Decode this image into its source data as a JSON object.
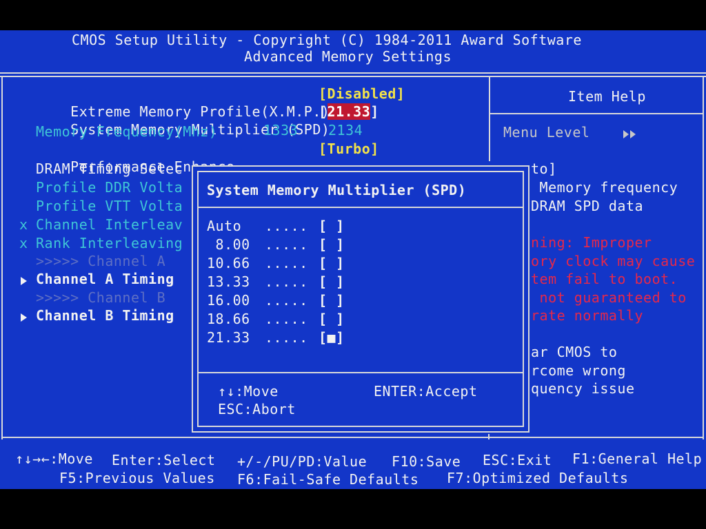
{
  "header": {
    "title": "CMOS Setup Utility - Copyright (C) 1984-2011 Award Software",
    "subtitle": "Advanced Memory Settings"
  },
  "menu": {
    "xmp": {
      "label": "Extreme Memory Profile(X.M.P.)",
      "value": "[Disabled]"
    },
    "multiplier": {
      "label": "System Memory Multiplier (SPD)",
      "value_open": "[",
      "value": "21.33",
      "value_close": "]"
    },
    "frequency": {
      "label": "Memory Frequency(Mhz)",
      "value1": "1333",
      "value2": "2134"
    },
    "perf": {
      "label": "Performance Enhance",
      "value": "[Turbo]"
    },
    "dram_timing": {
      "label": "DRAM Timing Selec"
    },
    "profile_ddr": {
      "label": "Profile DDR Volta"
    },
    "profile_vtt": {
      "label": "Profile VTT Volta"
    },
    "channel_interleave": {
      "prefix": "x",
      "label": "Channel Interleav"
    },
    "rank_interleave": {
      "prefix": "x",
      "label": "Rank Interleaving"
    },
    "channel_a_header": ">>>>> Channel A",
    "channel_a_timing": "Channel A Timing",
    "channel_b_header": ">>>>> Channel B",
    "channel_b_timing": "Channel B Timing"
  },
  "item_help": {
    "title": "Item Help",
    "menu_level_label": "Menu Level",
    "lines": [
      {
        "text": "to]",
        "color": "white"
      },
      {
        "text": " Memory frequency",
        "color": "white"
      },
      {
        "text": "DRAM SPD data",
        "color": "white"
      },
      {
        "text": "ning: Improper",
        "color": "red"
      },
      {
        "text": "ory clock may cause",
        "color": "red"
      },
      {
        "text": "tem fail to boot.",
        "color": "red"
      },
      {
        "text": " not guaranteed to",
        "color": "red"
      },
      {
        "text": "rate normally",
        "color": "red"
      },
      {
        "text": "ar CMOS to",
        "color": "white"
      },
      {
        "text": "rcome wrong",
        "color": "white"
      },
      {
        "text": "quency issue",
        "color": "white"
      }
    ]
  },
  "popup": {
    "title": "System Memory Multiplier (SPD)",
    "options": [
      {
        "label": "Auto ",
        "dots": ".....",
        "mark": "[ ]",
        "selected": false
      },
      {
        "label": " 8.00",
        "dots": ".....",
        "mark": "[ ]",
        "selected": false
      },
      {
        "label": "10.66",
        "dots": ".....",
        "mark": "[ ]",
        "selected": false
      },
      {
        "label": "13.33",
        "dots": ".....",
        "mark": "[ ]",
        "selected": false
      },
      {
        "label": "16.00",
        "dots": ".....",
        "mark": "[ ]",
        "selected": false
      },
      {
        "label": "18.66",
        "dots": ".....",
        "mark": "[ ]",
        "selected": false
      },
      {
        "label": "21.33",
        "dots": ".....",
        "mark": "[■]",
        "selected": true
      }
    ],
    "move": "↑↓:Move",
    "accept": "ENTER:Accept",
    "abort": "ESC:Abort"
  },
  "footer": {
    "move": "↑↓→←:Move",
    "select": "Enter:Select",
    "value": "+/-/PU/PD:Value",
    "save": "F10:Save",
    "exit": "ESC:Exit",
    "help": "F1:General Help",
    "previous": "F5:Previous Values",
    "failsafe": "F6:Fail-Safe Defaults",
    "optimized": "F7:Optimized Defaults"
  }
}
